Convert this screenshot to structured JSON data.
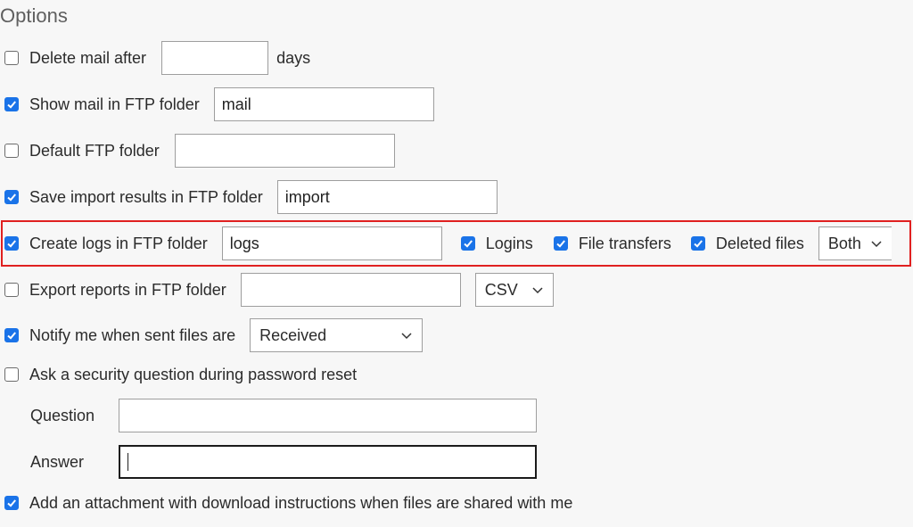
{
  "title": "Options",
  "rows": {
    "delete_mail": {
      "label": "Delete mail after",
      "checked": false,
      "value": "",
      "suffix": "days"
    },
    "show_mail": {
      "label": "Show mail in FTP folder",
      "checked": true,
      "value": "mail"
    },
    "default_ftp": {
      "label": "Default FTP folder",
      "checked": false,
      "value": ""
    },
    "save_import": {
      "label": "Save import results in FTP folder",
      "checked": true,
      "value": "import"
    },
    "create_logs": {
      "label": "Create logs in FTP folder",
      "checked": true,
      "value": "logs",
      "logins": {
        "label": "Logins",
        "checked": true
      },
      "file_transfers": {
        "label": "File transfers",
        "checked": true
      },
      "deleted_files": {
        "label": "Deleted files",
        "checked": true
      },
      "select_value": "Both"
    },
    "export_reports": {
      "label": "Export reports in FTP folder",
      "checked": false,
      "value": "",
      "select_value": "CSV"
    },
    "notify": {
      "label": "Notify me when sent files are",
      "checked": true,
      "select_value": "Received"
    },
    "security_question": {
      "label": "Ask a security question during password reset",
      "checked": false,
      "question_label": "Question",
      "question_value": "",
      "answer_label": "Answer",
      "answer_value": ""
    },
    "attachment": {
      "label": "Add an attachment with download instructions when files are shared with me",
      "checked": true
    }
  },
  "colors": {
    "accent": "#1a73e8",
    "highlight": "#e02020"
  },
  "icons": {
    "check": "check-icon",
    "dropdown": "chevron-down-icon"
  }
}
